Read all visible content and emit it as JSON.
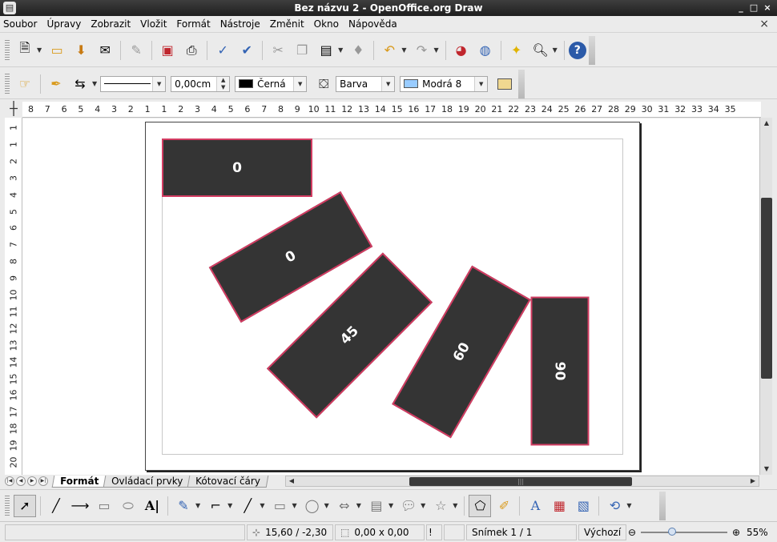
{
  "window": {
    "title": "Bez názvu 2 - OpenOffice.org Draw",
    "controls": [
      "_",
      "□",
      "×"
    ]
  },
  "menu": [
    "Soubor",
    "Úpravy",
    "Zobrazit",
    "Vložit",
    "Formát",
    "Nástroje",
    "Změnit",
    "Okno",
    "Nápověda"
  ],
  "doc_close": "×",
  "line_format": {
    "width": "0,00cm",
    "color_name": "Černá",
    "color_hex": "#000000"
  },
  "area_format": {
    "type": "Barva",
    "color_name": "Modrá 8",
    "color_hex": "#99ccff"
  },
  "ruler": {
    "h_labels": [
      "8",
      "7",
      "6",
      "5",
      "4",
      "3",
      "2",
      "1",
      "1",
      "2",
      "3",
      "4",
      "5",
      "6",
      "7",
      "8",
      "9",
      "10",
      "11",
      "12",
      "13",
      "14",
      "15",
      "16",
      "17",
      "18",
      "19",
      "20",
      "21",
      "22",
      "23",
      "24",
      "25",
      "26",
      "27",
      "28",
      "29",
      "30",
      "31",
      "32",
      "33",
      "34",
      "35"
    ],
    "v_labels": [
      "1",
      "1",
      "2",
      "3",
      "4",
      "5",
      "6",
      "7",
      "8",
      "9",
      "10",
      "11",
      "12",
      "13",
      "14",
      "15",
      "16",
      "17",
      "18",
      "19",
      "20"
    ]
  },
  "shapes": [
    {
      "label": "0",
      "rotation_deg": 0
    },
    {
      "label": "0",
      "rotation_deg": -30
    },
    {
      "label": "45",
      "rotation_deg": -45
    },
    {
      "label": "60",
      "rotation_deg": -60
    },
    {
      "label": "90",
      "rotation_deg": 90
    }
  ],
  "colors": {
    "shape_fill": "#343434",
    "shape_border": "#d23c62"
  },
  "tabs": [
    "Formát",
    "Ovládací prvky",
    "Kótovací čáry"
  ],
  "status": {
    "position": "15,60 / -2,30",
    "size": "0,00 x 0,00",
    "slide": "Snímek 1 / 1",
    "layout": "Výchozí",
    "zoom": "55%"
  }
}
